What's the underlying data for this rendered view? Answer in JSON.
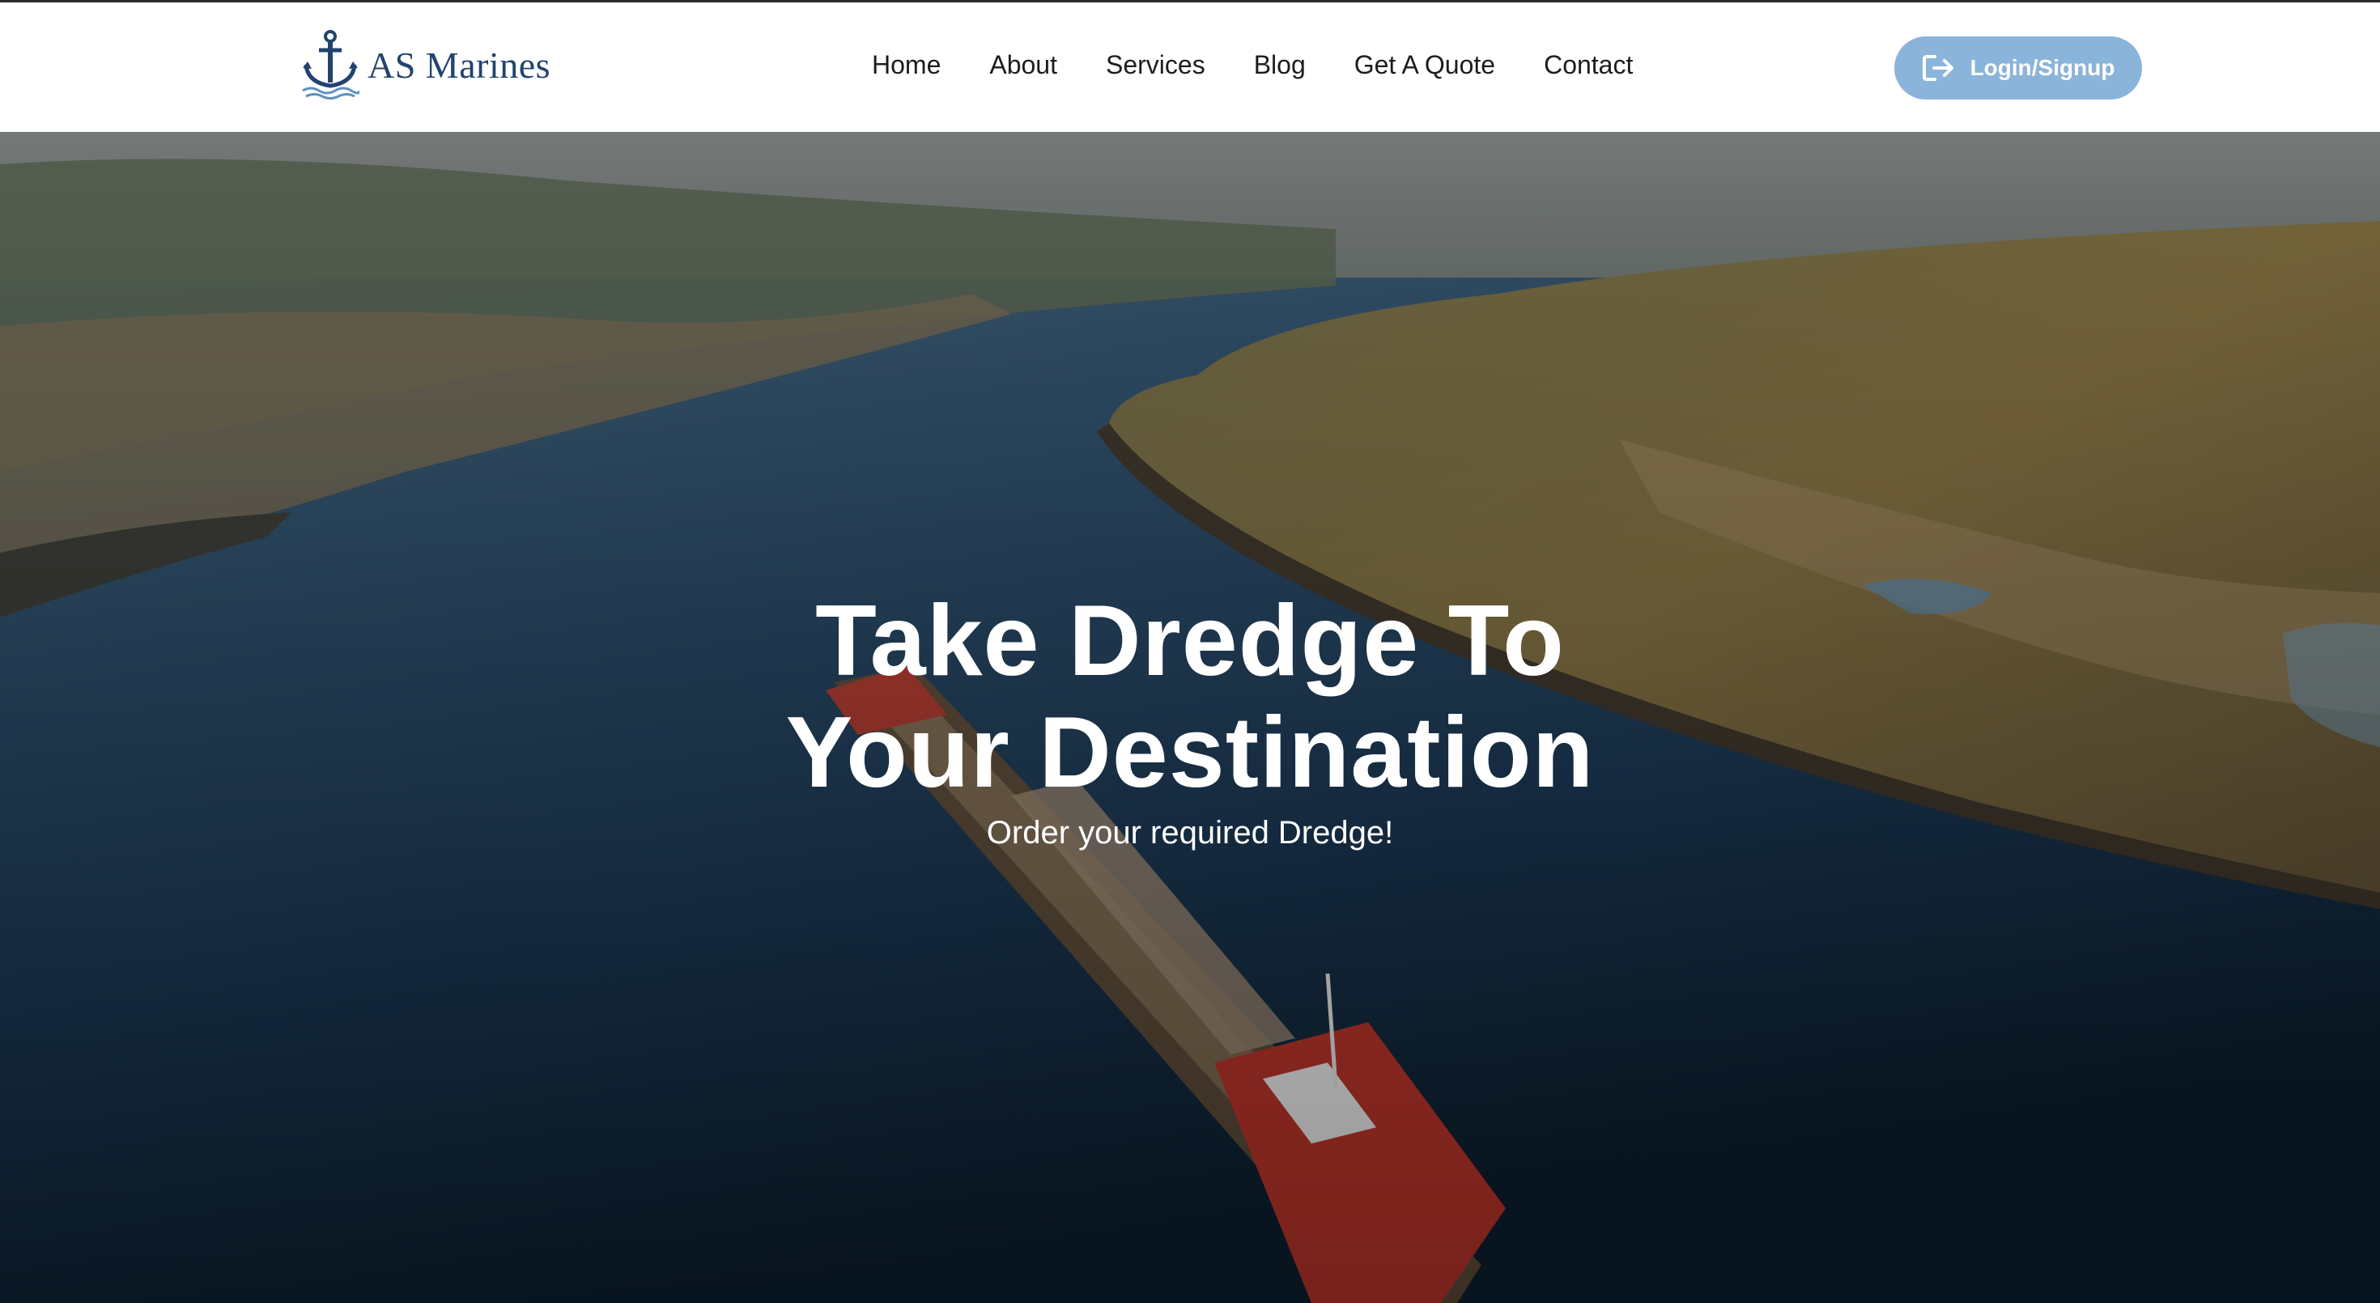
{
  "brand": {
    "name": "AS Marines",
    "logo_icon": "anchor-icon"
  },
  "nav": {
    "items": [
      {
        "label": "Home"
      },
      {
        "label": "About"
      },
      {
        "label": "Services"
      },
      {
        "label": "Blog"
      },
      {
        "label": "Get A Quote"
      },
      {
        "label": "Contact"
      }
    ]
  },
  "auth": {
    "label": "Login/Signup",
    "icon": "login-icon"
  },
  "hero": {
    "title_line1": "Take Dredge To",
    "title_line2": "Your Destination",
    "subtitle": "Order your required Dredge!",
    "image_subject": "dredger-ship-on-river"
  },
  "colors": {
    "brand_navy": "#22436e",
    "button_bg": "#8ab4da",
    "nav_text": "#1c1c1c",
    "hero_text": "#ffffff"
  }
}
